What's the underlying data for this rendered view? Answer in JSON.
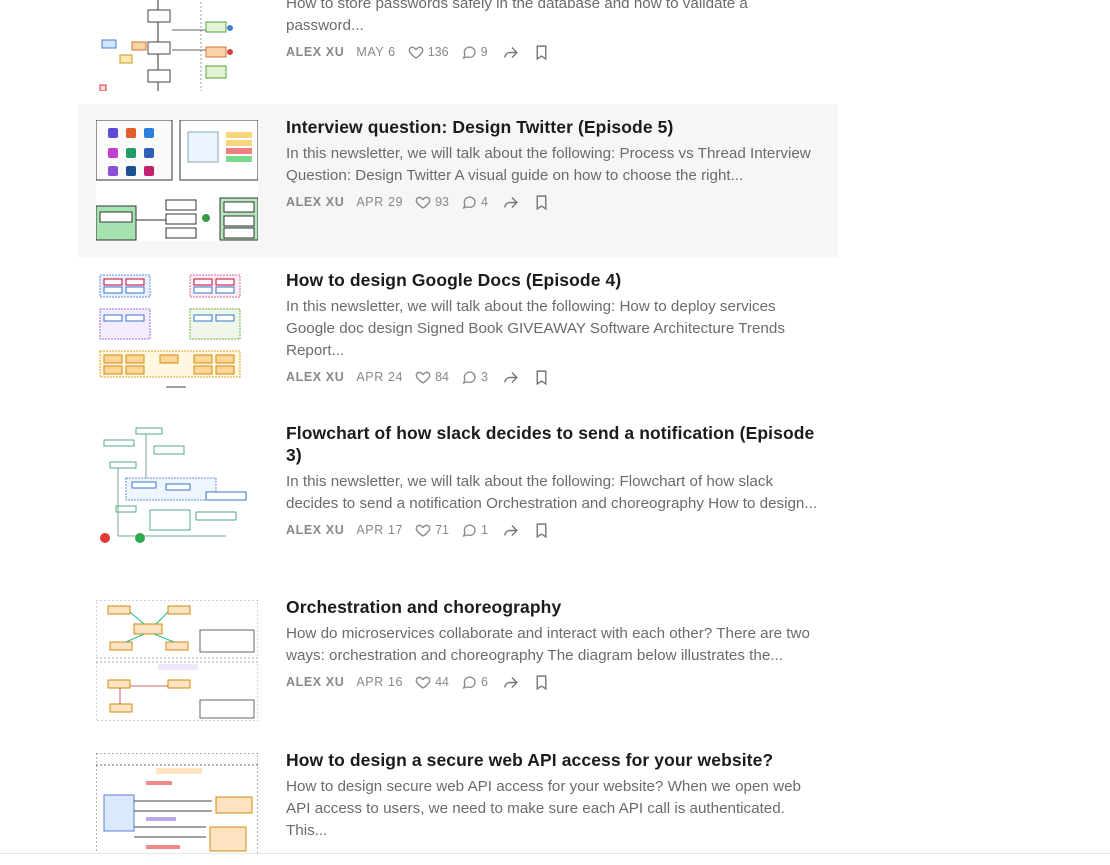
{
  "posts": [
    {
      "title": "",
      "desc": "In this newsletter, we will talk about the following: How does HTTPS work? How to store passwords safely in the database and how to validate a password...",
      "author": "ALEX XU",
      "date": "MAY 6",
      "likes": "136",
      "comments": "9"
    },
    {
      "title": "Interview question: Design Twitter (Episode 5)",
      "desc": "In this newsletter, we will talk about the following: Process vs Thread Interview Question: Design Twitter A visual guide on how to choose the right...",
      "author": "ALEX XU",
      "date": "APR 29",
      "likes": "93",
      "comments": "4"
    },
    {
      "title": "How to design Google Docs (Episode 4)",
      "desc": "In this newsletter, we will talk about the following: How to deploy services Google doc design Signed Book GIVEAWAY Software Architecture Trends Report...",
      "author": "ALEX XU",
      "date": "APR 24",
      "likes": "84",
      "comments": "3"
    },
    {
      "title": "Flowchart of how slack decides to send a notification (Episode 3)",
      "desc": "In this newsletter, we will talk about the following: Flowchart of how slack decides to send a notification Orchestration and choreography How to design...",
      "author": "ALEX XU",
      "date": "APR 17",
      "likes": "71",
      "comments": "1"
    },
    {
      "title": "Orchestration and choreography",
      "desc": "How do microservices collaborate and interact with each other? There are two ways: orchestration and choreography The diagram below illustrates the...",
      "author": "ALEX XU",
      "date": "APR 16",
      "likes": "44",
      "comments": "6"
    },
    {
      "title": "How to design a secure web API access for your website?",
      "desc": "How to design secure web API access for your website? When we open web API access to users, we need to make sure each API call is authenticated. This...",
      "author": "ALEX XU",
      "date": "",
      "likes": "",
      "comments": ""
    }
  ],
  "icons": {
    "like": "heart-icon",
    "comment": "comment-bubble-icon",
    "share": "share-arrow-icon",
    "bookmark": "bookmark-icon"
  },
  "colors": {
    "title": "#1b1b1b",
    "text": "#6b6b6b",
    "meta": "#888888",
    "hover_bg": "#f6f6f6"
  }
}
